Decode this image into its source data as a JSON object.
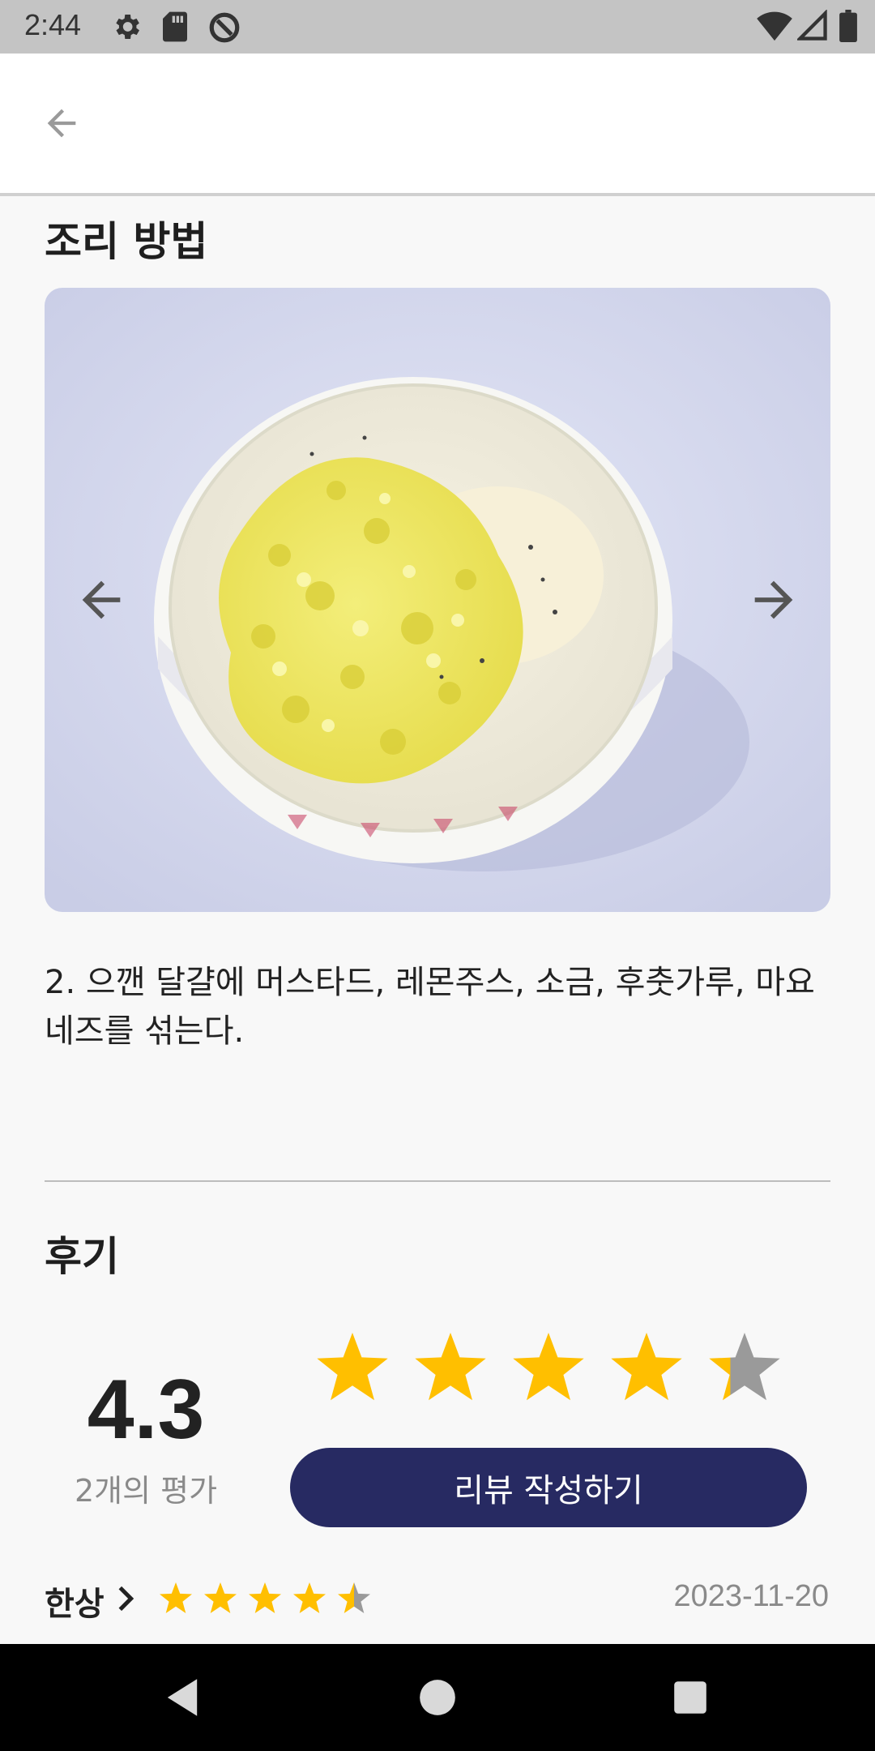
{
  "status_bar": {
    "time": "2:44",
    "icons_left": [
      "settings-icon",
      "sd-card-icon",
      "data-saver-icon"
    ],
    "icons_right": [
      "wifi-icon",
      "cell-signal-icon",
      "battery-icon"
    ]
  },
  "app_bar": {
    "back_icon": "arrow-back-icon"
  },
  "recipe": {
    "section_title": "조리 방법",
    "step_text": "2. 으깬 달걀에 머스타드, 레몬주스, 소금, 후춧가루, 마요네즈를 섞는다.",
    "photo_description_icon": "food-photo",
    "prev_icon": "arrow-left-icon",
    "next_icon": "arrow-right-icon"
  },
  "reviews": {
    "section_title": "후기",
    "rating_value": "4.3",
    "rating_count": "2개의 평가",
    "rating_stars": 4.3,
    "write_button": "리뷰 작성하기",
    "items": [
      {
        "author": "한상",
        "stars": 4.5,
        "date": "2023-11-20"
      }
    ]
  },
  "colors": {
    "accent": "#272a62",
    "star_fill": "#ffbf00",
    "star_empty": "#9a9a9a",
    "status_bar": "#c4c4c4"
  },
  "nav_bar": {
    "icons": [
      "nav-back-icon",
      "nav-home-icon",
      "nav-recents-icon"
    ]
  }
}
